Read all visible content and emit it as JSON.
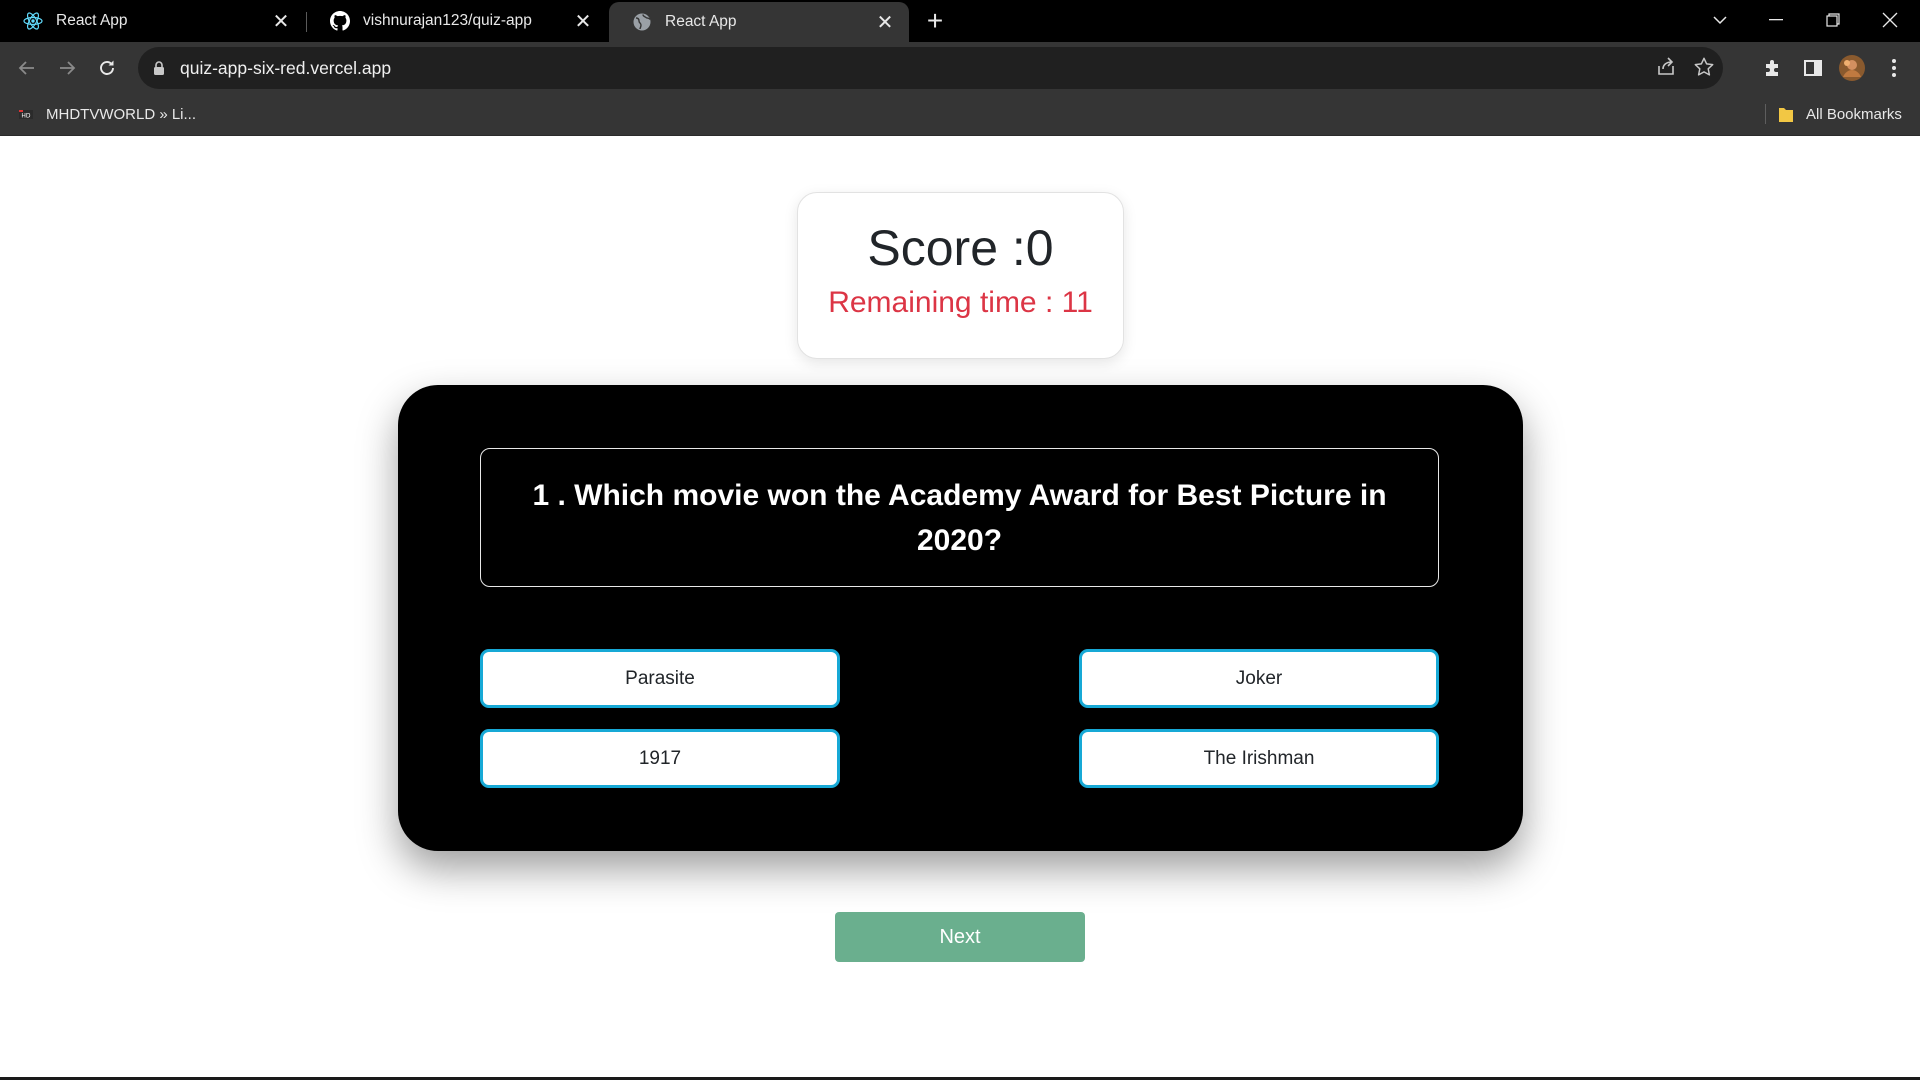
{
  "browser": {
    "tabs": [
      {
        "title": "React App",
        "icon": "react-icon",
        "active": false
      },
      {
        "title": "vishnurajan123/quiz-app",
        "icon": "github-icon",
        "active": false
      },
      {
        "title": "React App",
        "icon": "globe-icon",
        "active": true
      }
    ],
    "url": "quiz-app-six-red.vercel.app",
    "bookmarks": [
      {
        "label": "MHDTVWORLD » Li..."
      }
    ],
    "all_bookmarks_label": "All Bookmarks"
  },
  "quiz": {
    "score_text": "Score :0",
    "remaining_time_text": "Remaining time : 11",
    "question": "1 . Which movie won the Academy Award for Best Picture in 2020?",
    "options": [
      "Parasite",
      "Joker",
      "1917",
      "The Irishman"
    ],
    "next_label": "Next"
  },
  "colors": {
    "card_background": "#000000",
    "option_border": "#17a9d6",
    "time_text": "#dc3545",
    "next_button": "#6aaf8e"
  }
}
